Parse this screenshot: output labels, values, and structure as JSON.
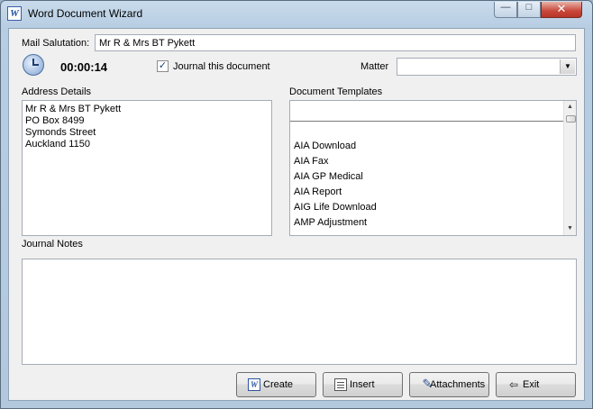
{
  "window": {
    "title": "Word Document Wizard",
    "app_icon_glyph": "W",
    "controls": {
      "minimize": "—",
      "maximize": "□",
      "close": "✕"
    }
  },
  "salutation": {
    "label": "Mail Salutation:",
    "value": "Mr R & Mrs BT Pykett"
  },
  "timer": {
    "value": "00:00:14"
  },
  "journal_checkbox": {
    "label": "Journal this document",
    "checked": true,
    "check_glyph": "✓"
  },
  "matter": {
    "label": "Matter",
    "value": "",
    "arrow": "▼"
  },
  "address": {
    "label": "Address Details",
    "lines": [
      "Mr R & Mrs BT Pykett",
      "PO Box 8499",
      "Symonds Street",
      "Auckland 1150"
    ]
  },
  "templates": {
    "label": "Document Templates",
    "search_value": "",
    "items": [
      "AIA Download",
      "AIA Fax",
      "AIA GP Medical",
      "AIA Report",
      "AIG Life Download",
      "AMP Adjustment"
    ],
    "scroll_up": "▲",
    "scroll_down": "▼"
  },
  "journal_notes": {
    "label": "Journal Notes",
    "value": ""
  },
  "buttons": {
    "create": "Create",
    "insert": "Insert",
    "attachments": "Attachments",
    "exit": "Exit"
  },
  "icons": {
    "create": "W",
    "attachments": "✎",
    "exit": "⇦"
  }
}
